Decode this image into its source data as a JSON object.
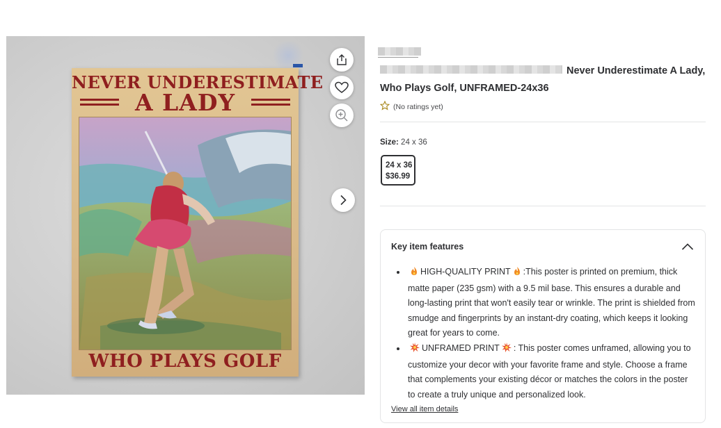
{
  "product": {
    "title": "Never Underestimate A Lady, Who Plays Golf, UNFRAMED-24x36",
    "rating_text": "(No ratings yet)",
    "size_label": "Size:",
    "size_value": "24 x 36",
    "option": {
      "size": "24 x 36",
      "price": "$36.99"
    }
  },
  "image": {
    "poster_line1": "NEVER UNDERESTIMATE",
    "poster_line2": "A LADY",
    "poster_bottom": "WHO PLAYS GOLF"
  },
  "features": {
    "heading": "Key item features",
    "items": [
      {
        "title": "HIGH-QUALITY PRINT",
        "text": ":This poster is printed on premium, thick matte paper (235 gsm) with a 9.5 mil base. This ensures a durable and long-lasting print that won't easily tear or wrinkle. The print is shielded from smudge and fingerprints by an instant-dry coating, which keeps it looking great for years to come.",
        "icon": "fire-icon"
      },
      {
        "title": "UNFRAMED PRINT",
        "text": ": This poster comes unframed, allowing you to customize your decor with your favorite frame and style. Choose a frame that complements your existing décor or matches the colors in the poster to create a truly unique and personalized look.",
        "icon": "collision-icon"
      }
    ],
    "view_all": "View all item details"
  },
  "colors": {
    "poster_red": "#8f1f1f",
    "text": "#2e2f32",
    "border": "#e3e4e5"
  }
}
